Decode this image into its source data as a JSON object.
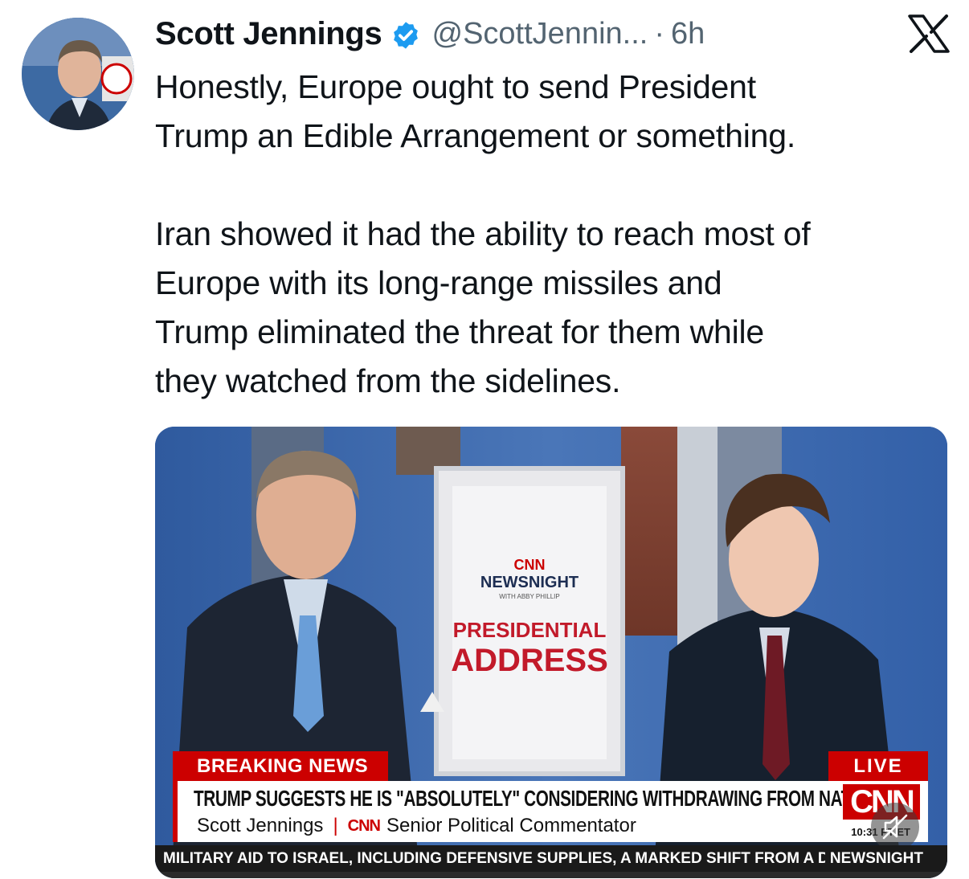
{
  "tweet": {
    "author": {
      "name": "Scott Jennings",
      "handle": "@ScottJennin...",
      "verified": true,
      "avatar_icon": "avatar-photo"
    },
    "separator": "·",
    "time": "6h",
    "platform_icon": "x-logo-icon",
    "text_lines_1": [
      "Honestly, Europe ought to send President",
      "Trump an Edible Arrangement or something."
    ],
    "text_lines_2": [
      "Iran showed it had the ability to reach most of",
      "Europe with its long-range missiles and",
      "Trump eliminated the threat for them while",
      "they watched from the sidelines."
    ]
  },
  "media": {
    "screen_logo": "CNN",
    "screen_show": "NEWSNIGHT",
    "screen_show_sub": "WITH ABBY PHILLIP",
    "screen_title_1": "PRESIDENTIAL",
    "screen_title_2": "ADDRESS",
    "breaking_label": "BREAKING NEWS",
    "live_label": "LIVE",
    "headline": "TRUMP SUGGESTS HE IS \"ABSOLUTELY\" CONSIDERING WITHDRAWING FROM NATO",
    "guest_name": "Scott Jennings",
    "subline_separator": "|",
    "guest_network": "CNN",
    "guest_title": "Senior Political Commentator",
    "network_logo": "CNN",
    "clock": "10:31 PT ET",
    "ticker_text": "MILITARY AID TO ISRAEL, INCLUDING DEFENSIVE SUPPLIES, A MARKED SHIFT FROM A D",
    "ticker_brand": "NEWSNIGHT",
    "mute_icon": "muted-speaker-icon"
  },
  "colors": {
    "text": "#0f1419",
    "secondary": "#536471",
    "verified": "#1d9bf0",
    "cnn_red": "#cc0000"
  }
}
